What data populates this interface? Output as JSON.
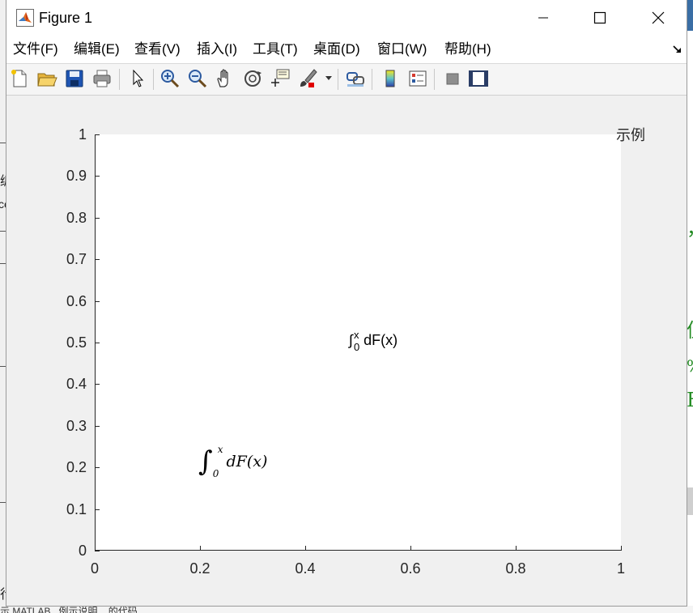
{
  "window": {
    "title": "Figure 1",
    "controls": {
      "minimize": "minimize",
      "maximize": "maximize",
      "close": "close"
    }
  },
  "menu": {
    "items": [
      {
        "label": "文件(F)"
      },
      {
        "label": "编辑(E)"
      },
      {
        "label": "查看(V)"
      },
      {
        "label": "插入(I)"
      },
      {
        "label": "工具(T)"
      },
      {
        "label": "桌面(D)"
      },
      {
        "label": "窗口(W)"
      },
      {
        "label": "帮助(H)"
      }
    ]
  },
  "toolbar": {
    "buttons": [
      "new-figure-icon",
      "open-file-icon",
      "save-icon",
      "print-icon",
      "edit-plot-arrow-icon",
      "zoom-in-icon",
      "zoom-out-icon",
      "pan-hand-icon",
      "rotate-3d-icon",
      "data-cursor-icon",
      "brush-icon",
      "link-plot-icon",
      "colorbar-icon",
      "legend-icon",
      "hide-plot-tools-icon",
      "show-plot-tools-icon"
    ]
  },
  "legend_label": "示例",
  "annotations": {
    "tex": {
      "prefix": "∫",
      "upper": "x",
      "lower": "0",
      "body": " dF(x)"
    },
    "latex": {
      "prefix": "∫",
      "upper": "x",
      "lower": "0",
      "body": "dF(x)"
    }
  },
  "chart_data": {
    "type": "scatter",
    "x": [
      0.5,
      0.2
    ],
    "y": [
      0.5,
      0.2
    ],
    "xlim": [
      0,
      1
    ],
    "ylim": [
      0,
      1
    ],
    "xticks": [
      "0",
      "0.2",
      "0.4",
      "0.6",
      "0.8",
      "1"
    ],
    "yticks": [
      "0",
      "0.1",
      "0.2",
      "0.3",
      "0.4",
      "0.5",
      "0.6",
      "0.7",
      "0.8",
      "0.9",
      "1"
    ],
    "grid": false,
    "title": "",
    "xlabel": "",
    "ylabel": ""
  },
  "background": {
    "left_glyphs": [
      "编",
      "ce",
      "行"
    ],
    "right_glyphs": [
      "，",
      "值",
      "%",
      "F"
    ],
    "bottom_text": "示 MATLAB...例示说明... 的代码"
  }
}
